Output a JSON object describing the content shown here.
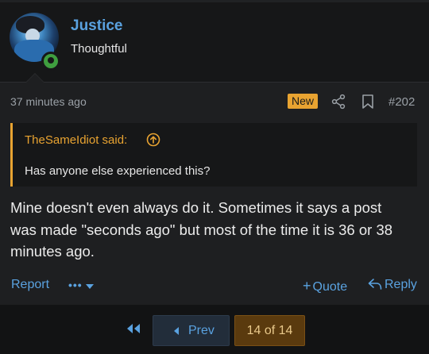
{
  "user": {
    "name": "Justice",
    "title": "Thoughtful",
    "avatar": "avatar-image",
    "status_icon": "online-status-icon"
  },
  "post": {
    "time_ago": "37 minutes ago",
    "new_badge": "New",
    "share_icon": "share-icon",
    "bookmark_icon": "bookmark-icon",
    "number": "#202",
    "quote": {
      "author": "TheSameIdiot said:",
      "jump_icon": "arrow-up-circle-icon",
      "text": "Has anyone else experienced this?"
    },
    "lines": [
      "Mine doesn't even always do it. Sometimes it says a post",
      "was made \"seconds ago\" but most of the time it is 36 or 38",
      "minutes ago."
    ],
    "actions": {
      "report": "Report",
      "more": "•••",
      "quote": "Quote",
      "quote_icon": "plus-icon",
      "reply": "Reply",
      "reply_icon": "reply-arrow-icon"
    }
  },
  "pager": {
    "first_icon": "double-chevron-left-icon",
    "prev": "Prev",
    "current": "14 of 14"
  },
  "colors": {
    "accent": "#5aa2e0",
    "badge": "#e8a331",
    "background": "#161718",
    "post_background": "#1e1f21"
  }
}
